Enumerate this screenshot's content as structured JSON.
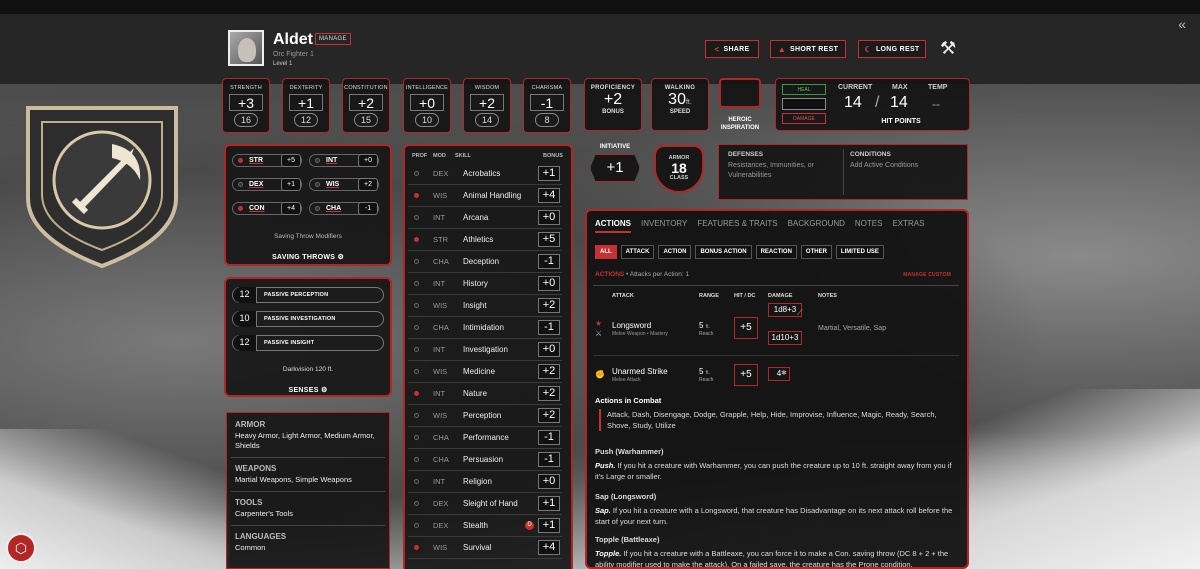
{
  "header": {
    "name": "Aldet",
    "manage": "MANAGE",
    "subtitle": "Orc  Fighter 1",
    "level": "Level 1",
    "share": "SHARE",
    "short_rest": "SHORT REST",
    "long_rest": "LONG REST"
  },
  "abilities": [
    {
      "label": "STRENGTH",
      "mod": "+3",
      "score": "16"
    },
    {
      "label": "DEXTERITY",
      "mod": "+1",
      "score": "12"
    },
    {
      "label": "CONSTITUTION",
      "mod": "+2",
      "score": "15"
    },
    {
      "label": "INTELLIGENCE",
      "mod": "+0",
      "score": "10"
    },
    {
      "label": "WISDOM",
      "mod": "+2",
      "score": "14"
    },
    {
      "label": "CHARISMA",
      "mod": "-1",
      "score": "8"
    }
  ],
  "proficiency": {
    "title": "PROFICIENCY",
    "value": "+2",
    "sub": "BONUS"
  },
  "speed": {
    "title": "WALKING",
    "value": "30",
    "unit": "ft.",
    "sub": "SPEED"
  },
  "inspiration": {
    "line1": "HEROIC",
    "line2": "INSPIRATION"
  },
  "hp": {
    "heal": "HEAL",
    "damage": "DAMAGE",
    "current_label": "CURRENT",
    "max_label": "MAX",
    "temp_label": "TEMP",
    "current": "14",
    "slash": "/",
    "max": "14",
    "temp": "--",
    "title": "HIT POINTS"
  },
  "saves": {
    "items": [
      {
        "name": "STR",
        "bonus": "+5",
        "prof": true
      },
      {
        "name": "INT",
        "bonus": "+0",
        "prof": false
      },
      {
        "name": "DEX",
        "bonus": "+1",
        "prof": false
      },
      {
        "name": "WIS",
        "bonus": "+2",
        "prof": false
      },
      {
        "name": "CON",
        "bonus": "+4",
        "prof": true
      },
      {
        "name": "CHA",
        "bonus": "-1",
        "prof": false
      }
    ],
    "modifiers": "Saving Throw Modifiers",
    "title": "SAVING THROWS"
  },
  "senses": {
    "items": [
      {
        "value": "12",
        "label": "PASSIVE PERCEPTION"
      },
      {
        "value": "10",
        "label": "PASSIVE INVESTIGATION"
      },
      {
        "value": "12",
        "label": "PASSIVE INSIGHT"
      }
    ],
    "darkvision": "Darkvision 120 ft.",
    "title": "SENSES"
  },
  "proficiencies": {
    "armor_h": "ARMOR",
    "armor": "Heavy Armor, Light Armor, Medium Armor, Shields",
    "weapons_h": "WEAPONS",
    "weapons": "Martial Weapons, Simple Weapons",
    "tools_h": "TOOLS",
    "tools": "Carpenter's Tools",
    "languages_h": "LANGUAGES",
    "languages": "Common"
  },
  "skills": {
    "head_prof": "PROF",
    "head_mod": "MOD",
    "head_skill": "SKILL",
    "head_bonus": "BONUS",
    "items": [
      {
        "ab": "DEX",
        "name": "Acrobatics",
        "bonus": "+1",
        "prof": false
      },
      {
        "ab": "WIS",
        "name": "Animal Handling",
        "bonus": "+4",
        "prof": true
      },
      {
        "ab": "INT",
        "name": "Arcana",
        "bonus": "+0",
        "prof": false
      },
      {
        "ab": "STR",
        "name": "Athletics",
        "bonus": "+5",
        "prof": true
      },
      {
        "ab": "CHA",
        "name": "Deception",
        "bonus": "-1",
        "prof": false
      },
      {
        "ab": "INT",
        "name": "History",
        "bonus": "+0",
        "prof": false
      },
      {
        "ab": "WIS",
        "name": "Insight",
        "bonus": "+2",
        "prof": false
      },
      {
        "ab": "CHA",
        "name": "Intimidation",
        "bonus": "-1",
        "prof": false
      },
      {
        "ab": "INT",
        "name": "Investigation",
        "bonus": "+0",
        "prof": false
      },
      {
        "ab": "WIS",
        "name": "Medicine",
        "bonus": "+2",
        "prof": false
      },
      {
        "ab": "INT",
        "name": "Nature",
        "bonus": "+2",
        "prof": true
      },
      {
        "ab": "WIS",
        "name": "Perception",
        "bonus": "+2",
        "prof": false
      },
      {
        "ab": "CHA",
        "name": "Performance",
        "bonus": "-1",
        "prof": false
      },
      {
        "ab": "CHA",
        "name": "Persuasion",
        "bonus": "-1",
        "prof": false
      },
      {
        "ab": "INT",
        "name": "Religion",
        "bonus": "+0",
        "prof": false
      },
      {
        "ab": "DEX",
        "name": "Sleight of Hand",
        "bonus": "+1",
        "prof": false
      },
      {
        "ab": "DEX",
        "name": "Stealth",
        "bonus": "+1",
        "prof": false
      },
      {
        "ab": "WIS",
        "name": "Survival",
        "bonus": "+4",
        "prof": true
      }
    ]
  },
  "initiative": {
    "title": "INITIATIVE",
    "value": "+1"
  },
  "armor_class": {
    "top": "ARMOR",
    "value": "18",
    "bottom": "CLASS"
  },
  "defenses": {
    "title": "DEFENSES",
    "text": "Resistances, Immunities, or Vulnerabilities"
  },
  "conditions": {
    "title": "CONDITIONS",
    "text": "Add Active Conditions"
  },
  "main": {
    "tabs": [
      "ACTIONS",
      "INVENTORY",
      "FEATURES & TRAITS",
      "BACKGROUND",
      "NOTES",
      "EXTRAS"
    ],
    "filters": [
      "ALL",
      "ATTACK",
      "ACTION",
      "BONUS ACTION",
      "REACTION",
      "OTHER",
      "LIMITED USE"
    ],
    "actions_title": "ACTIONS",
    "actions_sub": " • Attacks per Action: 1",
    "manage_custom": "MANAGE CUSTOM",
    "col_attack": "ATTACK",
    "col_range": "RANGE",
    "col_hit": "HIT / DC",
    "col_damage": "DAMAGE",
    "col_notes": "NOTES",
    "attacks": [
      {
        "name": "Longsword",
        "sub": "Melee Weapon • Mastery",
        "range": "5",
        "unit": "ft.",
        "reach": "Reach",
        "hit": "+5",
        "dmg1": "1d8+3",
        "dmg2": "1d10+3",
        "notes": "Martial, Versatile, Sap"
      },
      {
        "name": "Unarmed Strike",
        "sub": "Melee Attack",
        "range": "5",
        "unit": "ft.",
        "reach": "Reach",
        "hit": "+5",
        "dmg1": "4"
      }
    ],
    "combat_title": "Actions in Combat",
    "combat_list": "Attack, Dash, Disengage, Dodge, Grapple, Help, Hide, Improvise, Influence, Magic, Ready, Search, Shove, Study, Utilize",
    "features": [
      {
        "title": "Push (Warhammer)",
        "lead": "Push.",
        "text": " If you hit a creature with Warhammer, you can push the creature up to 10 ft. straight away from you if it's Large or smaller."
      },
      {
        "title": "Sap (Longsword)",
        "lead": "Sap.",
        "text": " If you hit a creature with a Longsword, that creature has Disadvantage on its next attack roll before the start of your next turn."
      },
      {
        "title": "Topple (Battleaxe)",
        "lead": "Topple.",
        "text": " If you hit a creature with a Battleaxe, you can force it to make a Con. saving throw (DC 8 + 2 + the ability modifier used to make the attack). On a failed save, the creature has the Prone condition."
      }
    ]
  },
  "colors": {
    "accent": "#c53131",
    "panel": "#161616",
    "heal": "#3c9a3c"
  }
}
